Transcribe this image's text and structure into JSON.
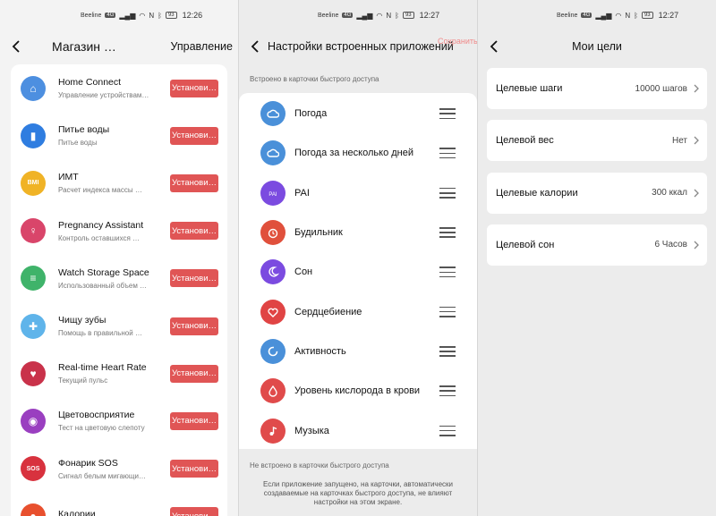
{
  "panel1": {
    "status": {
      "carrier": "Beeline",
      "net": "Wi-Fi",
      "time": "12:26",
      "battery": "93"
    },
    "title": "Магазин …",
    "manage": "Управление",
    "install_label": "Установи…",
    "apps": [
      {
        "name": "Home Connect",
        "desc": "Управление устройствам…",
        "color": "#4d8fe0",
        "glyph": "⌂"
      },
      {
        "name": "Питье воды",
        "desc": "Питье воды",
        "color": "#2f7de0",
        "glyph": "▮"
      },
      {
        "name": "ИМТ",
        "desc": "Расчет индекса массы …",
        "color": "#f0b326",
        "glyph": "BMI"
      },
      {
        "name": "Pregnancy Assistant",
        "desc": "Контроль оставшихся …",
        "color": "#d9456a",
        "glyph": "♀"
      },
      {
        "name": "Watch Storage Space",
        "desc": "Использованный объем …",
        "color": "#3fb36a",
        "glyph": "≡"
      },
      {
        "name": "Чищу зубы",
        "desc": "Помощь в правильной …",
        "color": "#5fb4ea",
        "glyph": "✚"
      },
      {
        "name": "Real-time Heart Rate",
        "desc": "Текущий пульс",
        "color": "#c9324a",
        "glyph": "♥"
      },
      {
        "name": "Цветовосприятие",
        "desc": "Тест на цветовую слепоту",
        "color": "#9a3fc0",
        "glyph": "◉"
      },
      {
        "name": "Фонарик SOS",
        "desc": "Сигнал белым мигающи…",
        "color": "#d8323e",
        "glyph": "SOS"
      },
      {
        "name": "Калории",
        "desc": "",
        "color": "#e8502e",
        "glyph": "●"
      }
    ]
  },
  "panel2": {
    "status": {
      "carrier": "Beeline",
      "time": "12:27",
      "battery": "93"
    },
    "title": "Настройки встроенных приложений",
    "save": "Сохранить",
    "added_label": "Встроено в карточки быстрого доступа",
    "tiles": [
      {
        "label": "Погода",
        "color": "#4a90d9",
        "icon": "cloud-icon"
      },
      {
        "label": "Погода за несколько дней",
        "color": "#4a90d9",
        "icon": "cloud-icon"
      },
      {
        "label": "PAI",
        "color": "#7b4be0",
        "icon": "pai-icon"
      },
      {
        "label": "Будильник",
        "color": "#e0503c",
        "icon": "alarm-icon"
      },
      {
        "label": "Сон",
        "color": "#7b4be0",
        "icon": "moon-icon"
      },
      {
        "label": "Сердцебиение",
        "color": "#e04444",
        "icon": "heart-icon"
      },
      {
        "label": "Активность",
        "color": "#4a90d9",
        "icon": "activity-icon"
      },
      {
        "label": "Уровень кислорода в крови",
        "color": "#e04b4b",
        "icon": "drop-icon"
      },
      {
        "label": "Музыка",
        "color": "#e04b4b",
        "icon": "music-icon"
      }
    ],
    "not_added_label": "Не встроено в карточки быстрого доступа",
    "note": "Если приложение запущено, на карточки, автоматически создаваемые на карточках быстрого доступа, не влияют настройки на этом экране."
  },
  "panel3": {
    "status": {
      "carrier": "Beeline",
      "time": "12:27",
      "battery": "93"
    },
    "title": "Мои цели",
    "goals": [
      {
        "label": "Целевые шаги",
        "value": "10000 шагов"
      },
      {
        "label": "Целевой вес",
        "value": "Нет"
      },
      {
        "label": "Целевые калории",
        "value": "300 ккал"
      },
      {
        "label": "Целевой сон",
        "value": "6 Часов"
      }
    ]
  }
}
